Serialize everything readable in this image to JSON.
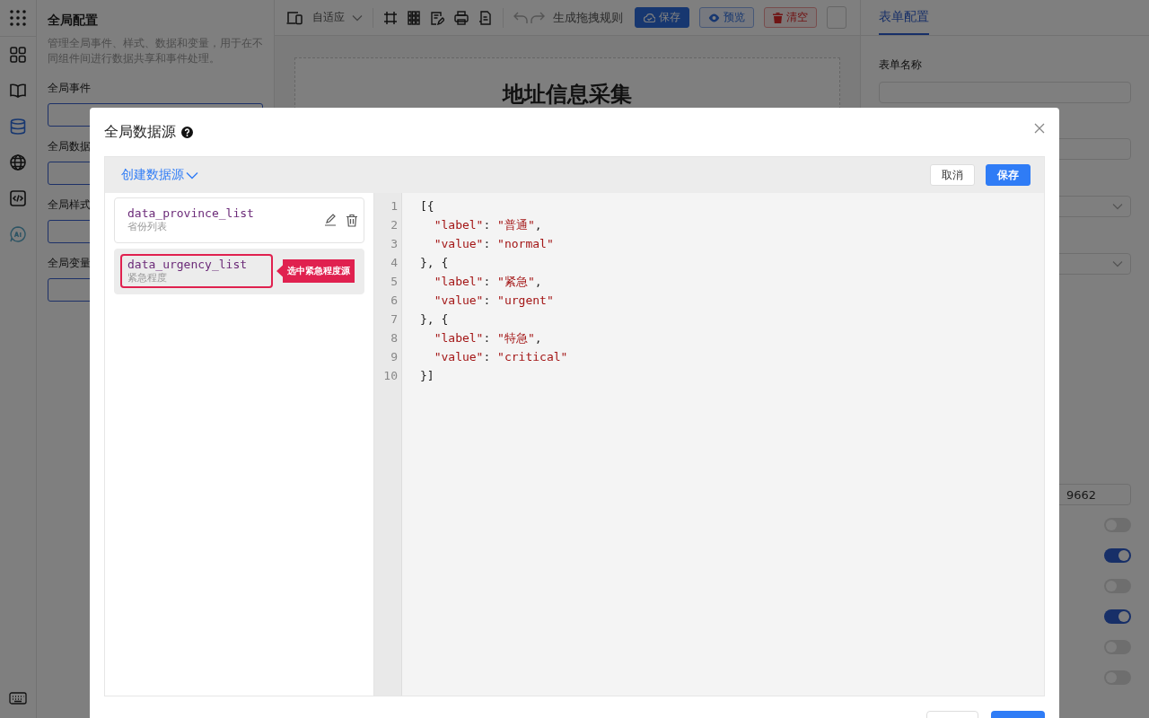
{
  "rail": {
    "items": [
      {
        "kind": "apps",
        "selected": false
      },
      {
        "kind": "blocks",
        "selected": false
      },
      {
        "kind": "book",
        "selected": false
      },
      {
        "kind": "database",
        "selected": true
      },
      {
        "kind": "globe",
        "selected": false
      },
      {
        "kind": "code",
        "selected": false
      },
      {
        "kind": "ai",
        "selected": false
      },
      {
        "kind": "keyboard",
        "selected": false
      }
    ]
  },
  "left_panel": {
    "title": "全局配置",
    "description": "管理全局事件、样式、数据和变量，用于在不同组件间进行数据共享和事件处理。",
    "sections": [
      {
        "label": "全局事件"
      },
      {
        "label": "全局数据"
      },
      {
        "label": "全局样式"
      },
      {
        "label": "全局变量"
      }
    ]
  },
  "toolbar": {
    "device_select": "自适应",
    "generate_rules": "生成拖拽规则",
    "buttons": [
      {
        "label": "保存",
        "kind": "primary"
      },
      {
        "label": "预览",
        "kind": "outline"
      },
      {
        "label": "清空",
        "kind": "danger"
      }
    ]
  },
  "canvas": {
    "title": "地址信息采集"
  },
  "right_panel": {
    "tabs": [
      {
        "label": "表单配置",
        "selected": true
      }
    ],
    "field_label": "表单名称",
    "partial_value": "9662",
    "switches": [
      {
        "on": false
      },
      {
        "on": true
      },
      {
        "on": false
      },
      {
        "on": true
      },
      {
        "on": false
      },
      {
        "on": false
      }
    ]
  },
  "dialog": {
    "title": "全局数据源",
    "create_menu": "创建数据源",
    "cancel": "取消",
    "save": "保存",
    "callout": "选中紧急程度源",
    "sources": [
      {
        "name": "data_province_list",
        "description": "省份列表",
        "selected": false
      },
      {
        "name": "data_urgency_list",
        "description": "紧急程度",
        "selected": true
      }
    ],
    "code_lines": [
      {
        "number": "1",
        "text": "[{"
      },
      {
        "number": "2",
        "text": "  \"label\": \"普通\","
      },
      {
        "number": "3",
        "text": "  \"value\": \"normal\""
      },
      {
        "number": "4",
        "text": "}, {"
      },
      {
        "number": "5",
        "text": "  \"label\": \"紧急\","
      },
      {
        "number": "6",
        "text": "  \"value\": \"urgent\""
      },
      {
        "number": "7",
        "text": "}, {"
      },
      {
        "number": "8",
        "text": "  \"label\": \"特急\","
      },
      {
        "number": "9",
        "text": "  \"value\": \"critical\""
      },
      {
        "number": "10",
        "text": "}]"
      }
    ]
  }
}
